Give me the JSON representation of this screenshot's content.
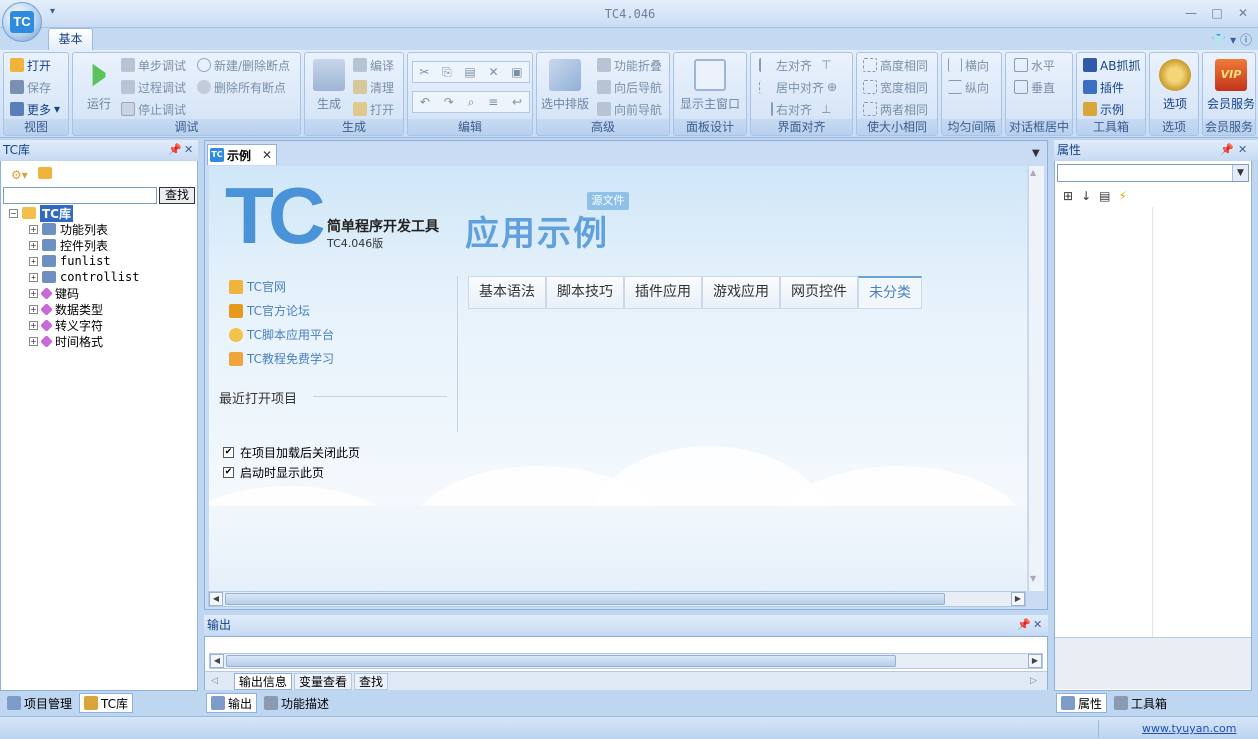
{
  "app": {
    "title": "TC4.046",
    "logo_text": "TC"
  },
  "ribbon": {
    "tab": "基本",
    "groups": {
      "view": {
        "label": "视图",
        "open": "打开",
        "save": "保存",
        "more": "更多"
      },
      "debug": {
        "label": "调试",
        "run": "运行",
        "step": "单步调试",
        "proc": "过程调试",
        "stop": "停止调试",
        "newbp": "新建/删除断点",
        "delbp": "删除所有断点"
      },
      "build": {
        "label": "生成",
        "gen": "生成",
        "compile": "编译",
        "clean": "清理",
        "open": "打开"
      },
      "edit": {
        "label": "编辑"
      },
      "advanced": {
        "label": "高级",
        "select": "选中排版",
        "fold": "功能折叠",
        "back": "向后导航",
        "fwd": "向前导航"
      },
      "panel": {
        "label": "面板设计",
        "show": "显示主窗口"
      },
      "align": {
        "label": "界面对齐",
        "left": "左对齐",
        "center": "居中对齐",
        "right": "右对齐"
      },
      "size": {
        "label": "使大小相同",
        "h": "高度相同",
        "w": "宽度相同",
        "both": "两者相同"
      },
      "spacing": {
        "label": "均匀间隔",
        "h": "横向",
        "v": "纵向"
      },
      "dlgcenter": {
        "label": "对话框居中",
        "h": "水平",
        "v": "垂直"
      },
      "toolbox": {
        "label": "工具箱",
        "ab": "AB抓抓",
        "plugin": "插件",
        "example": "示例"
      },
      "options": {
        "label": "选项",
        "btn": "选项"
      },
      "member": {
        "label": "会员服务",
        "btn": "会员服务"
      }
    }
  },
  "left_panel": {
    "title": "TC库",
    "search_btn": "查找",
    "root": "TC库",
    "items": [
      "功能列表",
      "控件列表",
      "funlist",
      "controllist",
      "键码",
      "数据类型",
      "转义字符",
      "时间格式"
    ],
    "tabs": [
      "项目管理",
      "TC库"
    ]
  },
  "doc": {
    "tab": "示例",
    "brand_big": "TC",
    "brand_sub": "简单程序开发工具",
    "brand_ver": "TC4.046版",
    "headline": "应用示例",
    "badge": "源文件",
    "links": [
      "TC官网",
      "TC官方论坛",
      "TC脚本应用平台",
      "TC教程免费学习"
    ],
    "recent": "最近打开项目",
    "categories": [
      "基本语法",
      "脚本技巧",
      "插件应用",
      "游戏应用",
      "网页控件",
      "未分类"
    ],
    "selected_category": "未分类",
    "checks": [
      "在项目加载后关闭此页",
      "启动时显示此页"
    ]
  },
  "output": {
    "title": "输出",
    "tabs": [
      "输出信息",
      "变量查看",
      "查找"
    ],
    "bottom_tabs": [
      "输出",
      "功能描述"
    ]
  },
  "props": {
    "title": "属性",
    "tabs": [
      "属性",
      "工具箱"
    ]
  },
  "status": {
    "url": "www.tyuyan.com"
  }
}
